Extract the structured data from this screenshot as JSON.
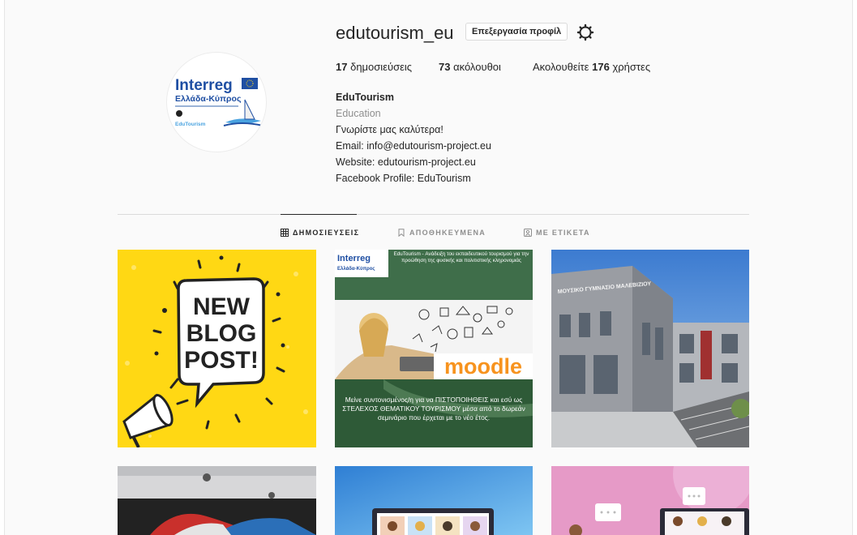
{
  "profile": {
    "username": "edutourism_eu",
    "edit_label": "Επεξεργασία προφίλ",
    "stats": {
      "posts_count": "17",
      "posts_label": "δημοσιεύσεις",
      "followers_count": "73",
      "followers_label": "ακόλουθοι",
      "following_prefix": "Ακολουθείτε",
      "following_count": "176",
      "following_suffix": "χρήστες"
    },
    "bio": {
      "name": "EduTourism",
      "category": "Education",
      "lines": [
        "Γνωρίστε μας καλύτερα!",
        "Email: info@edutourism-project.eu",
        "Website: edutourism-project.eu",
        "Facebook Profile: EduTourism"
      ]
    },
    "avatar": {
      "logo_title": "Interreg",
      "logo_subtitle": "Ελλάδα-Κύπρος",
      "logo_caption": "EduTourism"
    }
  },
  "tabs": [
    {
      "label": "ΔΗΜΟΣΙΕΥΣΕΙΣ",
      "icon": "grid-icon",
      "active": true
    },
    {
      "label": "ΑΠΟΘΗΚΕΥΜΕΝΑ",
      "icon": "bookmark-icon",
      "active": false
    },
    {
      "label": "ΜΕ ΕΤΙΚΕΤΑ",
      "icon": "tag-icon",
      "active": false
    }
  ],
  "posts": {
    "post1": {
      "lines": [
        "NEW",
        "BLOG",
        "POST!"
      ]
    },
    "post2": {
      "logo_title": "Interreg",
      "logo_subtitle": "Ελλάδα-Κύπρος",
      "header": "EduTourism - Ανάδειξη του εκπαιδευτικού τουρισμού για την προώθηση της φυσικής και πολιτιστικής κληρονομιάς",
      "moodle": "moodle",
      "footer": "Μείνε συντονισμένος/η για να ΠΙΣΤΟΠΟΙΗΘΕΙΣ και εσύ ως ΣΤΕΛΕΧΟΣ ΘΕΜΑΤΙΚΟΥ ΤΟΥΡΙΣΜΟΥ μέσα από το δωρεάν σεμινάριο που έρχεται με το νέο έτος."
    },
    "post3": {
      "sign": "ΜΟΥΣΙΚΟ ΓΥΜΝΑΣΙΟ ΜΑΛΕΒΙΖΙΟΥ"
    }
  },
  "colors": {
    "text": "#262626",
    "muted": "#8e8e8e",
    "border": "#dbdbdb",
    "background": "#fafafa",
    "interreg_blue": "#1f4fa3",
    "post1_yellow": "#ffd814"
  }
}
